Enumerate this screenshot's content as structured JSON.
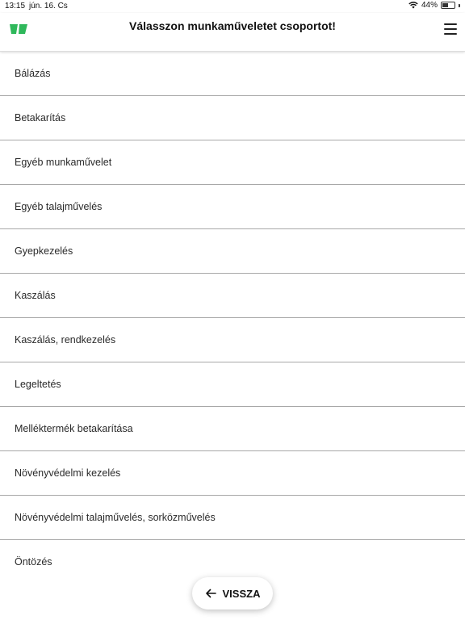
{
  "status_bar": {
    "time": "13:15",
    "date": "jún. 16. Cs",
    "battery": "44%",
    "battery_level": 0.44
  },
  "header": {
    "title": "Válasszon munkaműveletet csoportot!",
    "logo_color": "#2fb85b"
  },
  "items": [
    {
      "label": "Bálázás"
    },
    {
      "label": "Betakarítás"
    },
    {
      "label": "Egyéb munkaművelet"
    },
    {
      "label": "Egyéb talajművelés"
    },
    {
      "label": "Gyepkezelés"
    },
    {
      "label": "Kaszálás"
    },
    {
      "label": "Kaszálás, rendkezelés"
    },
    {
      "label": "Legeltetés"
    },
    {
      "label": "Melléktermék betakarítása"
    },
    {
      "label": "Növényvédelmi kezelés"
    },
    {
      "label": "Növényvédelmi talajművelés, sorközművelés"
    },
    {
      "label": "Öntözés"
    }
  ],
  "back_button": {
    "label": "VISSZA",
    "icon": "arrow-left-icon"
  }
}
